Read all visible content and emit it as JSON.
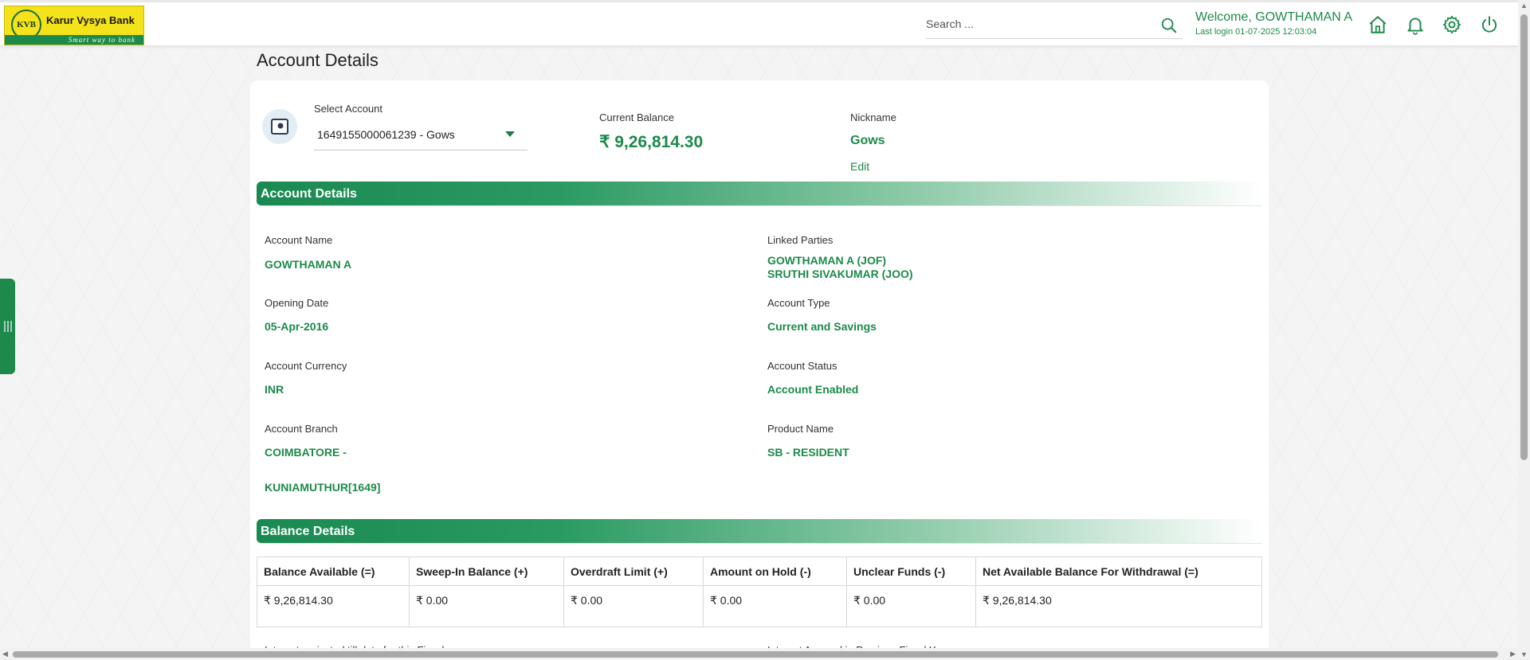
{
  "header": {
    "logo_initials": "KVB",
    "logo_name": "Karur Vysya Bank",
    "logo_tagline": "Smart way to bank",
    "search_placeholder": "Search ...",
    "welcome": "Welcome, GOWTHAMAN  A",
    "last_login": "Last login 01-07-2025 12:03:04",
    "icons": [
      "home-icon",
      "bell-icon",
      "gear-icon",
      "power-icon"
    ],
    "accent_color": "#1c8a4a"
  },
  "page_title": "Account Details",
  "account_selector": {
    "label": "Select Account",
    "value": "1649155000061239 - Gows"
  },
  "current_balance": {
    "label": "Current Balance",
    "value": "₹ 9,26,814.30"
  },
  "nickname": {
    "label": "Nickname",
    "value": "Gows",
    "edit_label": "Edit"
  },
  "account_details": {
    "heading": "Account Details",
    "account_name": {
      "label": "Account Name",
      "value": "GOWTHAMAN A"
    },
    "linked_parties": {
      "label": "Linked Parties",
      "values": [
        "GOWTHAMAN A (JOF)",
        "SRUTHI SIVAKUMAR (JOO)"
      ]
    },
    "opening_date": {
      "label": "Opening Date",
      "value": "05-Apr-2016"
    },
    "account_type": {
      "label": "Account Type",
      "value": "Current and Savings"
    },
    "account_currency": {
      "label": "Account Currency",
      "value": "INR"
    },
    "account_status": {
      "label": "Account Status",
      "value": "Account Enabled"
    },
    "account_branch": {
      "label": "Account Branch",
      "value_line1": "COIMBATORE -",
      "value_line2": "KUNIAMUTHUR[1649]"
    },
    "product_name": {
      "label": "Product Name",
      "value": "SB - RESIDENT"
    }
  },
  "balance_details": {
    "heading": "Balance Details",
    "columns": [
      "Balance Available (=)",
      "Sweep-In Balance (+)",
      "Overdraft Limit (+)",
      "Amount on Hold (-)",
      "Unclear Funds (-)",
      "Net Available Balance For Withdrawal (=)"
    ],
    "values": [
      "₹ 9,26,814.30",
      "₹ 0.00",
      "₹ 0.00",
      "₹ 0.00",
      "₹ 0.00",
      "₹ 9,26,814.30"
    ]
  },
  "cut_off_labels": [
    "Interest projected till date for this Fiscal",
    "Interest Accrued in Previous Fiscal Year"
  ]
}
